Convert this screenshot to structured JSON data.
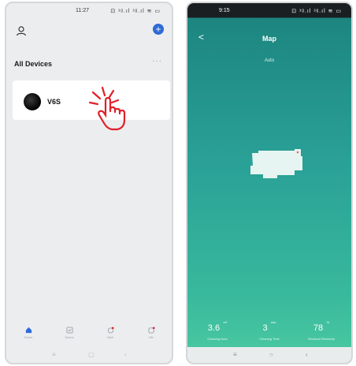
{
  "left_screen": {
    "status_time": "11:27",
    "status_icons": "⊡ ᵌᵍ.ıl ᵌᵍ.ıl ≋ ▭",
    "section_title": "All Devices",
    "more_label": "···",
    "add_label": "+",
    "device": {
      "name": "V6S"
    },
    "tabs": [
      {
        "icon": "home-icon",
        "label": "Home"
      },
      {
        "icon": "scene-icon",
        "label": "Scene"
      },
      {
        "icon": "mall-icon",
        "label": "Mall"
      },
      {
        "icon": "me-icon",
        "label": "Me"
      }
    ],
    "nav": {
      "menu": "≡",
      "home": "▢",
      "back": "‹"
    },
    "colors": {
      "accent": "#2f6bd6",
      "tap_gesture": "#e0202a"
    }
  },
  "right_screen": {
    "status_time": "9:15",
    "status_icons": "⊡ ᵌᵍ.ıl ᵌᵍ.ıl ≋ ▭",
    "back_label": "<",
    "title": "Map",
    "mode": "Auto",
    "stats": [
      {
        "value": "3.6",
        "unit": "m²",
        "label": "Cleaning Area"
      },
      {
        "value": "3",
        "unit": "min",
        "label": "Cleaning Time"
      },
      {
        "value": "78",
        "unit": "%",
        "label": "Residual Electricity"
      }
    ],
    "nav": {
      "menu": "≡",
      "home": "○",
      "back": "‹"
    },
    "colors": {
      "background": "#2aa197",
      "map_area": "#e6f5f1"
    }
  }
}
